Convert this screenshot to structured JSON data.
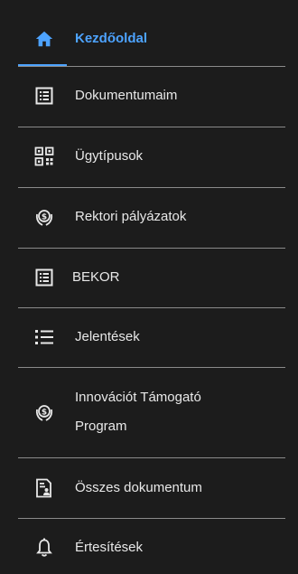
{
  "colors": {
    "background": "#1c1c1c",
    "accent": "#4da3ff",
    "text": "#e8e8e8",
    "divider": "#8a8a8a"
  },
  "nav": {
    "items": [
      {
        "label": "Kezdőoldal",
        "icon": "home-icon",
        "active": true
      },
      {
        "label": "Dokumentumaim",
        "icon": "list-document-icon"
      },
      {
        "label": "Ügytípusok",
        "icon": "qr-code-icon"
      },
      {
        "label": "Rektori pályázatok",
        "icon": "money-hand-icon"
      },
      {
        "label": "BEKOR",
        "icon": "list-document-icon"
      },
      {
        "label": "Jelentések",
        "icon": "bullet-list-icon"
      },
      {
        "label_line1": "Innovációt Támogató",
        "label_line2": "Program",
        "icon": "money-hand-icon"
      },
      {
        "label": "Összes dokumentum",
        "icon": "document-user-icon"
      },
      {
        "label": "Értesítések",
        "icon": "bell-icon"
      }
    ]
  }
}
